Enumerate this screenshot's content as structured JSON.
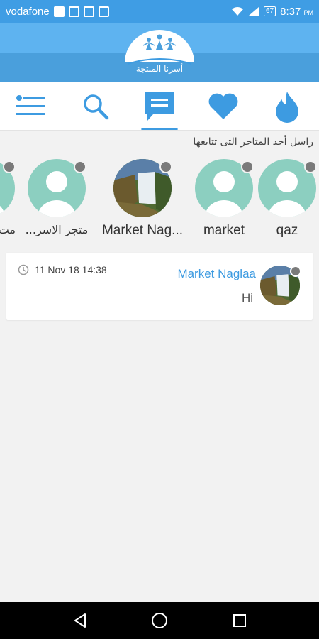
{
  "status_bar": {
    "carrier": "vodafone",
    "battery": "67",
    "time": "8:37",
    "time_suffix": "PM"
  },
  "header": {
    "logo_text": "أسرنا المنتجة"
  },
  "tabs": [
    {
      "name": "menu",
      "icon": "menu-icon",
      "active": false
    },
    {
      "name": "search",
      "icon": "search-icon",
      "active": false
    },
    {
      "name": "chat",
      "icon": "chat-icon",
      "active": true
    },
    {
      "name": "favorites",
      "icon": "heart-icon",
      "active": false
    },
    {
      "name": "trending",
      "icon": "flame-icon",
      "active": false
    }
  ],
  "followed": {
    "title": "راسل أحد المتاجر التى تتابعها",
    "stores": [
      {
        "name": "qaz",
        "avatar": "default-avatar"
      },
      {
        "name": "market",
        "avatar": "default-avatar"
      },
      {
        "name": "Market Nag...",
        "avatar": "waterfall-photo"
      },
      {
        "name": "متجر الاسر...",
        "avatar": "default-avatar"
      },
      {
        "name": "مت",
        "avatar": "default-avatar"
      }
    ]
  },
  "messages": [
    {
      "sender": "Market Naglaa",
      "text": "Hi",
      "time": "11 Nov 18 14:38",
      "avatar": "waterfall-photo"
    }
  ],
  "colors": {
    "primary": "#3d9be1",
    "header_light": "#5eb3f0",
    "avatar_bg": "#8ccfc0",
    "status_dot": "#7a7a7a"
  }
}
